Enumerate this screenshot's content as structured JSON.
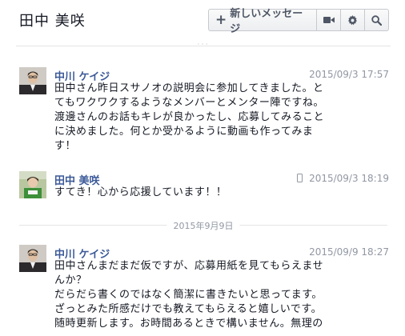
{
  "header": {
    "title": "田中 美咲",
    "new_message_label": "新しいメッセージ",
    "icons": [
      "plus-icon",
      "video-camera-icon",
      "gear-icon",
      "search-icon"
    ]
  },
  "messages": [
    {
      "author": "中川 ケイジ",
      "time": "2015/09/3 17:57",
      "mobile": false,
      "text": "田中さん昨日スサノオの説明会に参加してきました。と\nてもワクワクするようなメンバーとメンター陣ですね。\n渡邊さんのお話もキレが良かったし、応募してみること\nに決めました。何とか受かるように動画も作ってみま\nす！"
    },
    {
      "author": "田中 美咲",
      "time": "2015/09/3 18:19",
      "mobile": true,
      "text": "すてき！心から応援しています！！"
    },
    {
      "author": "中川 ケイジ",
      "time": "2015/09/9 18:27",
      "mobile": false,
      "text": "田中さんまだまだ仮ですが、応募用紙を見てもらえませ\nんか？\nだらだら書くのではなく簡潔に書きたいと思ってます。\nざっとみた所感だけでも教えてもらえると嬉しいです。\n随時更新します。お時間あるときで構いません。無理の"
    }
  ],
  "date_divider": "2015年9月9日",
  "colors": {
    "author_link": "#3b5998",
    "timestamp": "#9197a3",
    "divider": "#e5e5e5"
  }
}
